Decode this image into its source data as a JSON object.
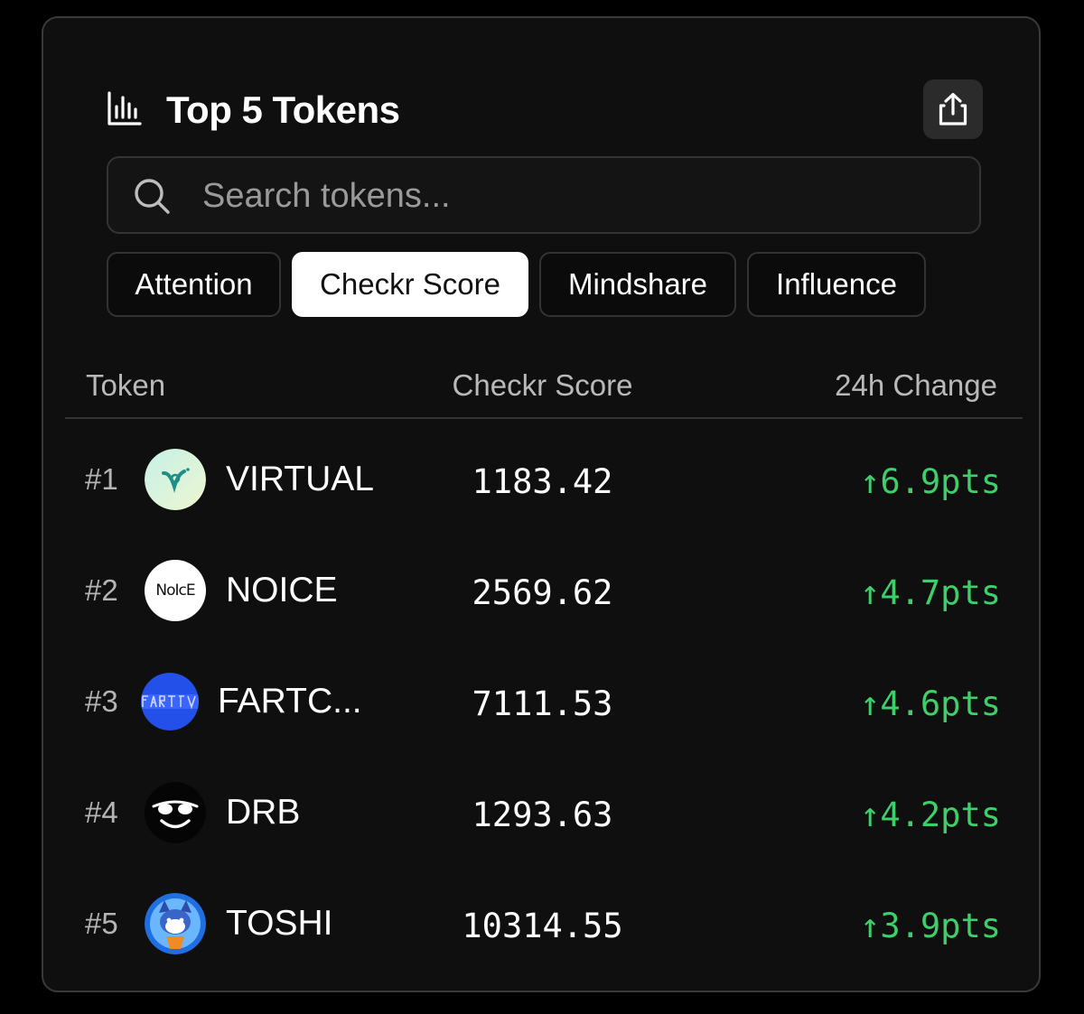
{
  "header": {
    "title": "Top 5 Tokens",
    "chart_icon": "bar-chart-icon",
    "share_icon": "share-icon"
  },
  "search": {
    "placeholder": "Search tokens...",
    "value": "",
    "icon": "search-icon"
  },
  "tabs": [
    {
      "label": "Attention",
      "active": false
    },
    {
      "label": "Checkr Score",
      "active": true
    },
    {
      "label": "Mindshare",
      "active": false
    },
    {
      "label": "Influence",
      "active": false
    }
  ],
  "table": {
    "columns": [
      "Token",
      "Checkr Score",
      "24h Change"
    ],
    "rows": [
      {
        "rank": "#1",
        "name": "VIRTUAL",
        "score": "1183.42",
        "change": "↑6.9pts",
        "logo": "virtual-logo"
      },
      {
        "rank": "#2",
        "name": "NOICE",
        "score": "2569.62",
        "change": "↑4.7pts",
        "logo": "noice-logo",
        "logo_text": "NoIcE"
      },
      {
        "rank": "#3",
        "name": "FARTC...",
        "score": "7111.53",
        "change": "↑4.6pts",
        "logo": "fartcoin-logo"
      },
      {
        "rank": "#4",
        "name": "DRB",
        "score": "1293.63",
        "change": "↑4.2pts",
        "logo": "drb-logo"
      },
      {
        "rank": "#5",
        "name": "TOSHI",
        "score": "10314.55",
        "change": "↑3.9pts",
        "logo": "toshi-logo"
      }
    ]
  },
  "colors": {
    "background": "#000000",
    "card": "#0f0f0f",
    "positive": "#3ecf6a",
    "active_tab_bg": "#ffffff"
  }
}
